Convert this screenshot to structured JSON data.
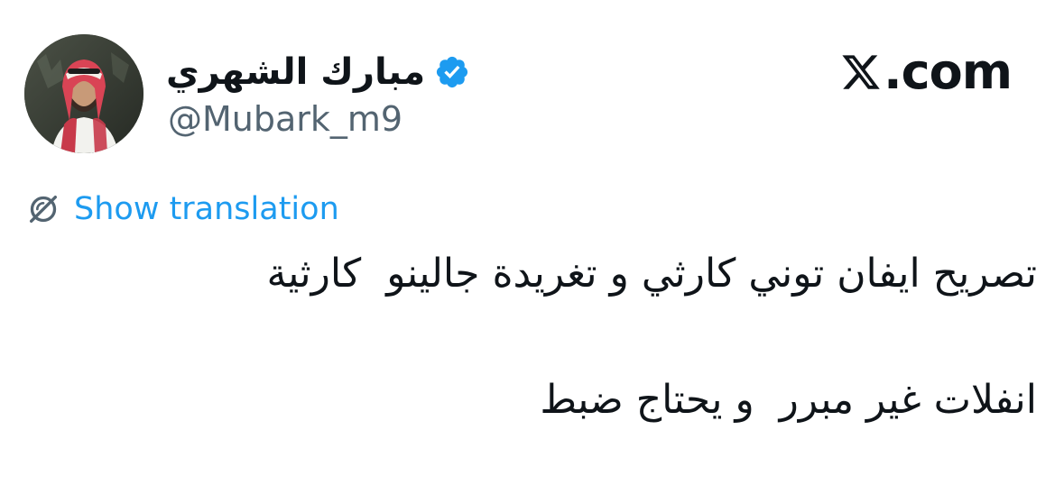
{
  "author": {
    "display_name": "مبارك الشهري",
    "handle": "@Mubark_m9",
    "verified": true
  },
  "site": {
    "logo_text": ".com",
    "logo_icon": "x-logo-icon"
  },
  "translation": {
    "label": "Show translation",
    "icon": "translate-icon"
  },
  "tweet": {
    "lines": [
      "تصريح ايفان توني كارثي و تغريدة جالينو  كارثية",
      "انفلات غير مبرر  و يحتاج ضبط"
    ]
  },
  "colors": {
    "link": "#1d9bf0",
    "verified_badge": "#1d9bf0",
    "handle": "#536471",
    "text": "#0f1419"
  }
}
